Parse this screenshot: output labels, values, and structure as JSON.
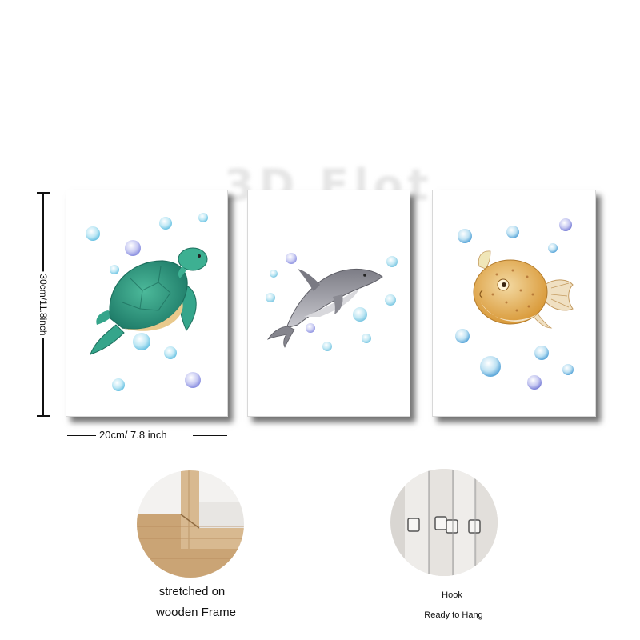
{
  "watermark": "3D Flot",
  "dimensions": {
    "height_label": "30cm/11.8inch",
    "width_label": "20cm/ 7.8 inch"
  },
  "panels": [
    {
      "subject": "sea-turtle"
    },
    {
      "subject": "dolphin"
    },
    {
      "subject": "pufferfish"
    }
  ],
  "features": [
    {
      "lines": [
        "stretched on",
        "wooden Frame"
      ]
    },
    {
      "lines": [
        "Hook",
        "Ready to Hang"
      ]
    }
  ],
  "colors": {
    "turtle": "#2a9d82",
    "dolphin": "#8d8d94",
    "pufferfish": "#e2a84c",
    "bubble": "#8fd4ec",
    "bubble_violet": "#a3a6e6",
    "frame_wood": "#d8b990"
  }
}
